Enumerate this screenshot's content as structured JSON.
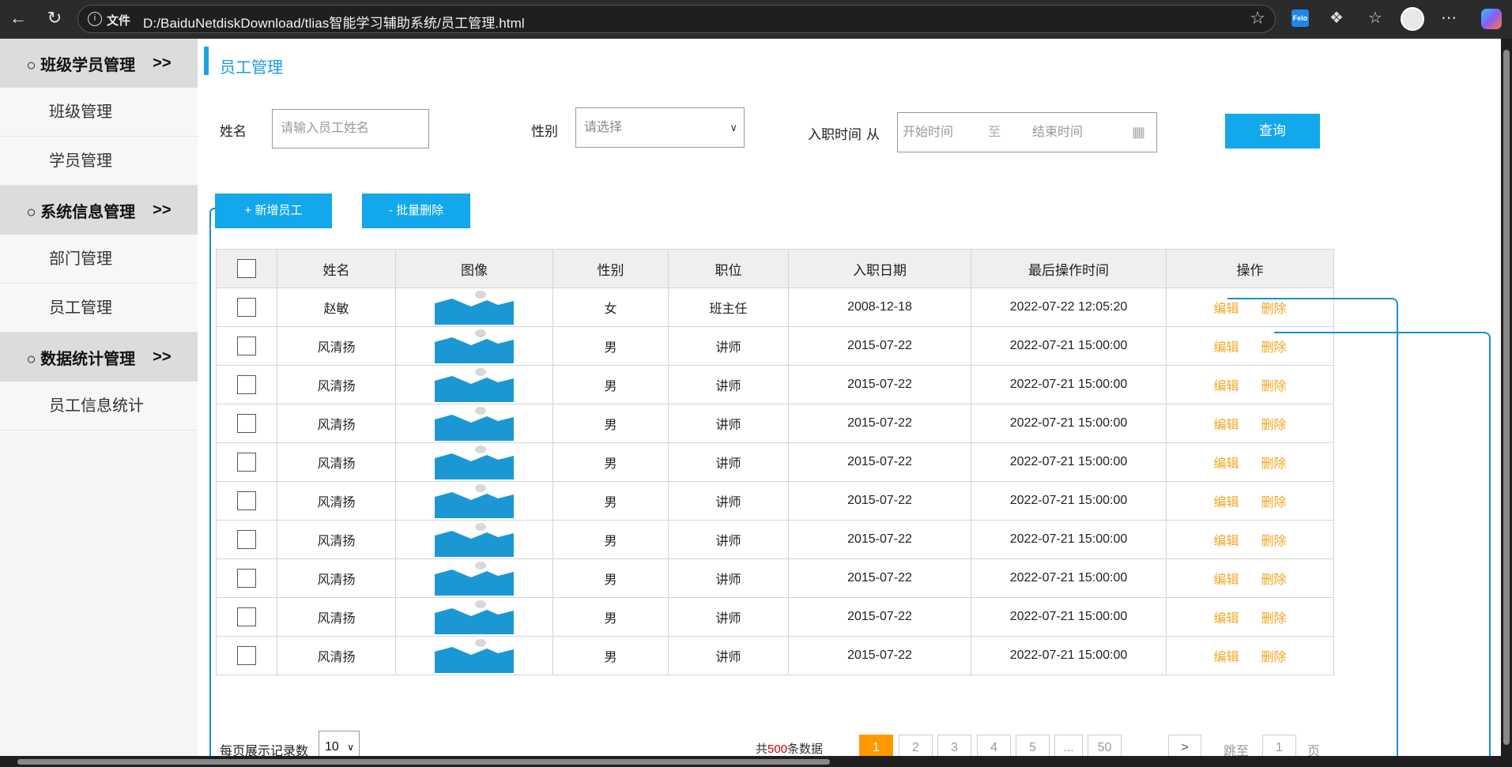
{
  "browser": {
    "file_label": "文件",
    "url": "D:/BaiduNetdiskDownload/tlias智能学习辅助系统/员工管理.html",
    "ext_felo": "Felo"
  },
  "sidebar": {
    "groups": [
      {
        "label": "○ 班级学员管理",
        "arrow": ">>",
        "items": [
          "班级管理",
          "学员管理"
        ]
      },
      {
        "label": "○ 系统信息管理",
        "arrow": ">>",
        "items": [
          "部门管理",
          "员工管理"
        ]
      },
      {
        "label": "○ 数据统计管理",
        "arrow": ">>",
        "items": [
          "员工信息统计"
        ]
      }
    ]
  },
  "page": {
    "title": "员工管理"
  },
  "search": {
    "name_label": "姓名",
    "name_placeholder": "请输入员工姓名",
    "gender_label": "性别",
    "gender_placeholder": "请选择",
    "date_label": "入职时间",
    "date_from": "从",
    "date_start_placeholder": "开始时间",
    "date_to": "至",
    "date_end_placeholder": "结束时间",
    "query_button": "查询"
  },
  "actions": {
    "add_button": "+ 新增员工",
    "batch_delete_button": "- 批量删除"
  },
  "table": {
    "headers": [
      "姓名",
      "图像",
      "性别",
      "职位",
      "入职日期",
      "最后操作时间",
      "操作"
    ],
    "edit_label": "编辑",
    "delete_label": "删除",
    "rows": [
      {
        "name": "赵敏",
        "gender": "女",
        "position": "班主任",
        "entry_date": "2008-12-18",
        "last_op": "2022-07-22 12:05:20"
      },
      {
        "name": "风清扬",
        "gender": "男",
        "position": "讲师",
        "entry_date": "2015-07-22",
        "last_op": "2022-07-21 15:00:00"
      },
      {
        "name": "风清扬",
        "gender": "男",
        "position": "讲师",
        "entry_date": "2015-07-22",
        "last_op": "2022-07-21 15:00:00"
      },
      {
        "name": "风清扬",
        "gender": "男",
        "position": "讲师",
        "entry_date": "2015-07-22",
        "last_op": "2022-07-21 15:00:00"
      },
      {
        "name": "风清扬",
        "gender": "男",
        "position": "讲师",
        "entry_date": "2015-07-22",
        "last_op": "2022-07-21 15:00:00"
      },
      {
        "name": "风清扬",
        "gender": "男",
        "position": "讲师",
        "entry_date": "2015-07-22",
        "last_op": "2022-07-21 15:00:00"
      },
      {
        "name": "风清扬",
        "gender": "男",
        "position": "讲师",
        "entry_date": "2015-07-22",
        "last_op": "2022-07-21 15:00:00"
      },
      {
        "name": "风清扬",
        "gender": "男",
        "position": "讲师",
        "entry_date": "2015-07-22",
        "last_op": "2022-07-21 15:00:00"
      },
      {
        "name": "风清扬",
        "gender": "男",
        "position": "讲师",
        "entry_date": "2015-07-22",
        "last_op": "2022-07-21 15:00:00"
      },
      {
        "name": "风清扬",
        "gender": "男",
        "position": "讲师",
        "entry_date": "2015-07-22",
        "last_op": "2022-07-21 15:00:00"
      }
    ]
  },
  "pagination": {
    "page_size_label": "每页展示记录数",
    "page_size_value": "10",
    "total_prefix": "共",
    "total_count": "500",
    "total_suffix": "条数据",
    "prev": "<",
    "pages": [
      "1",
      "2",
      "3",
      "4",
      "5",
      "...",
      "50"
    ],
    "current_page": "1",
    "next": ">",
    "jump_label": "跳至",
    "jump_value": "1",
    "page_unit": "页"
  },
  "colors": {
    "accent": "#13a7ec",
    "page_active": "#ff9800",
    "op_link": "#f5a623",
    "total_count": "#cc0000"
  }
}
